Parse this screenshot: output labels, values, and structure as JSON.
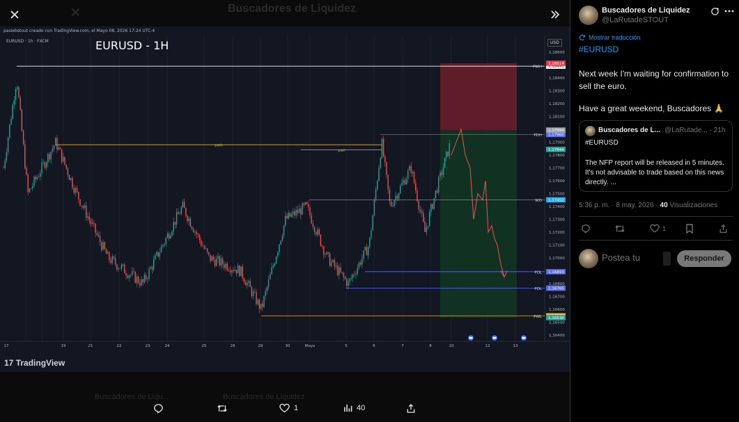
{
  "viewer": {
    "ghost_title": "Buscadores de Liquidez",
    "chart": {
      "top_note": "pasiebstout creado con TradingView.com, el Mayo 08, 2026 17:24 UTC-4",
      "symbol": "EURUSD · 1h · FXCM",
      "title": "EURUSD - 1H",
      "currency": "USD",
      "tv_logo": "TradingView",
      "price_ticks": [
        "1,18600",
        "1,18500",
        "1,18400",
        "1,18300",
        "1,18200",
        "1,18100",
        "1,18000",
        "1,17900",
        "1,17800",
        "1,17700",
        "1,17600",
        "1,17500",
        "1,17400",
        "1,17300",
        "1,17200",
        "1,17100",
        "1,17000",
        "1,16900",
        "1,16800",
        "1,16700",
        "1,16600",
        "1,16500",
        "1,16400"
      ],
      "date_ticks": [
        "17",
        "19",
        "21",
        "22",
        "23",
        "24",
        "25",
        "28",
        "29",
        "30",
        "Mayo",
        "5",
        "6",
        "7",
        "8",
        "10",
        "12",
        "13"
      ],
      "levels": [
        {
          "label": "PWH",
          "price": "1,18491",
          "color": "#ffffff"
        },
        {
          "label": "PDH",
          "price": "1,17960",
          "color": "#5b6cf0"
        },
        {
          "label": "WO",
          "price": "1,17452",
          "color": "#2aa7e0"
        },
        {
          "label": "PDL",
          "price": "1,16893",
          "color": "#5b6cf0"
        },
        {
          "label": "PDL",
          "price": "1,16765",
          "color": "#5b6cf0"
        },
        {
          "label": "PWL",
          "price": "1,16550",
          "color": "#e0b040"
        }
      ],
      "extra_price_tags": [
        {
          "price": "1,18514",
          "color": "#f23645"
        },
        {
          "price": "1,17994",
          "color": "#9aa0aa"
        },
        {
          "price": "1,17844",
          "color": "#26a69a"
        },
        {
          "price": "1,16536",
          "color": "#26a69a"
        }
      ],
      "inner_labels": [
        "pwh",
        "pwl"
      ]
    },
    "ghost_quotes": [
      "Buscadores de Liqu...",
      "Buscadores de Liquidez"
    ],
    "actions": {
      "reply_count": "",
      "repost_count": "",
      "like_count": "1",
      "views_count": "40",
      "share_count": ""
    }
  },
  "post": {
    "author_name": "Buscadores de Liquidez",
    "author_handle": "@LaRutadeSTOUT",
    "translate_label": "Mostrar traducción",
    "hashtag": "#EURUSD",
    "line1": "Next week I'm waiting for confirmation to sell the euro.",
    "line2": "Have a great weekend, Buscadores 🙏",
    "quote": {
      "name": "Buscadores de L...",
      "handle_time": "@LaRutade... · 21h",
      "hashtag": "#EURUSD",
      "text": "The NFP report will be released in 5 minutes. It's not advisable to trade based on this news directly. ..."
    },
    "time": "5:36 p. m. · 8 may. 2026 ·",
    "views_number": "40",
    "views_label": "Visualizaciones",
    "actions": {
      "like_count": "1"
    },
    "reply_placeholder": "Postea tu",
    "reply_button": "Responder"
  }
}
